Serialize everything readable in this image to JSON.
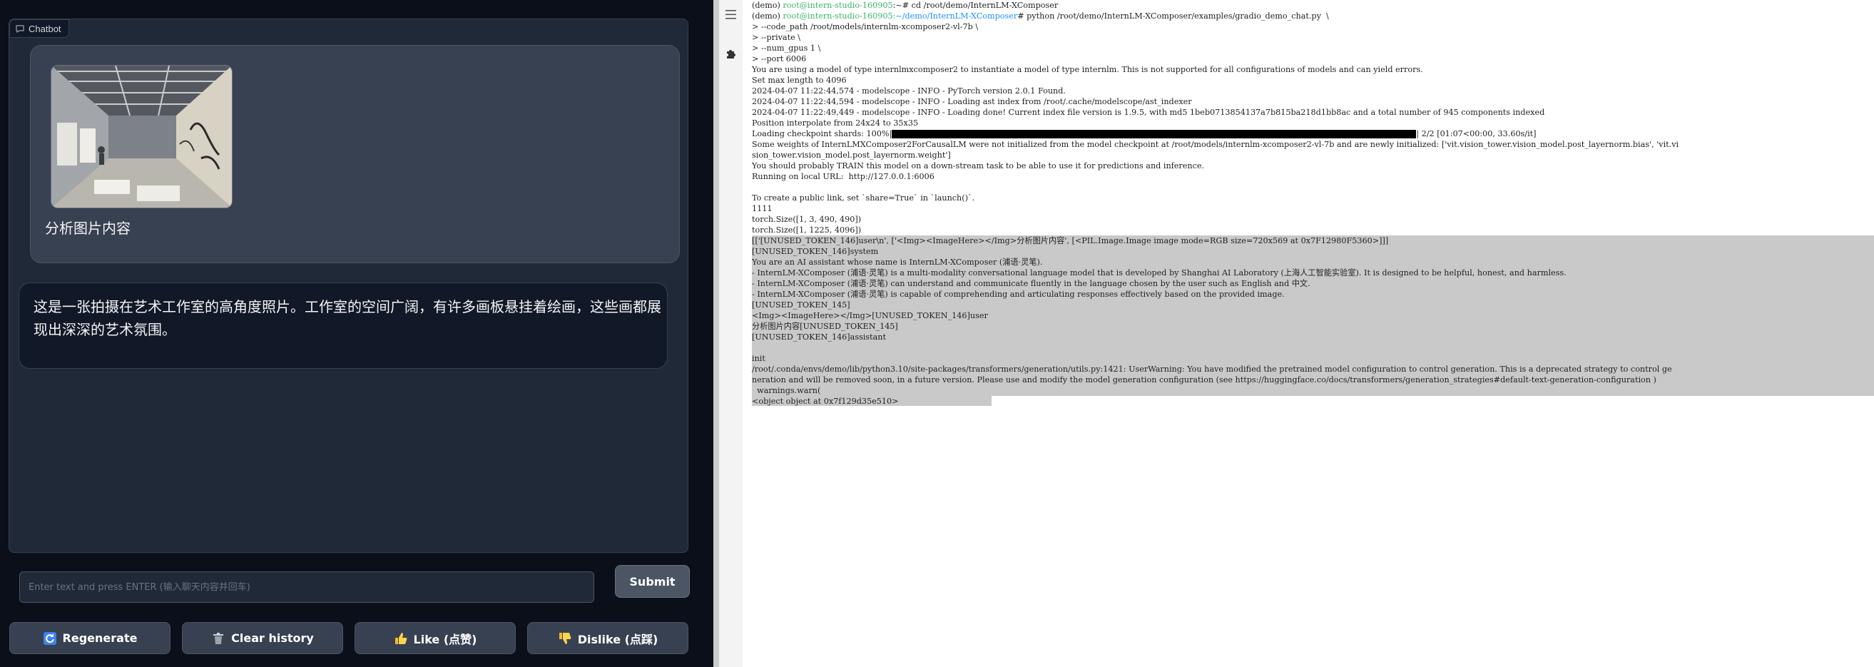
{
  "chatbot": {
    "label": "Chatbot",
    "user_message": "分析图片内容",
    "bot_message": "这是一张拍摄在艺术工作室的高角度照片。工作室的空间广阔，有许多画板悬挂着绘画，这些画都展现出深深的艺术氛围。"
  },
  "input": {
    "placeholder": "Enter text and press ENTER (输入聊天内容并回车)"
  },
  "buttons": {
    "submit": "Submit",
    "regenerate": "Regenerate",
    "clear_history": "Clear history",
    "like": "Like (点赞)",
    "dislike": "Dislike (点踩)"
  },
  "icons": {
    "chat": "chat-icon",
    "regenerate": "refresh-icon",
    "clear": "trash-icon",
    "like": "thumbs-up-icon",
    "dislike": "thumbs-down-icon",
    "sidebar_list": "list-icon",
    "sidebar_ext": "puzzle-icon"
  },
  "terminal": {
    "cmd1": {
      "env": "(demo) ",
      "user": "root@intern-studio-160905",
      "path": ":~",
      "cmd": "# cd /root/demo/InternLM-XComposer"
    },
    "cmd2": {
      "env": "(demo) ",
      "user": "root@intern-studio-160905",
      "path": ":~/demo/InternLM-XComposer",
      "cmd": "# python /root/demo/InternLM-XComposer/examples/gradio_demo_chat.py  \\"
    },
    "lines": [
      "> --code_path /root/models/internlm-xcomposer2-vl-7b \\",
      "> --private \\",
      "> --num_gpus 1 \\",
      "> --port 6006",
      "You are using a model of type internlmxcomposer2 to instantiate a model of type internlm. This is not supported for all configurations of models and can yield errors.",
      "Set max length to 4096",
      "2024-04-07 11:22:44,574 - modelscope - INFO - PyTorch version 2.0.1 Found.",
      "2024-04-07 11:22:44,594 - modelscope - INFO - Loading ast index from /root/.cache/modelscope/ast_indexer",
      "2024-04-07 11:22:49,449 - modelscope - INFO - Loading done! Current index file version is 1.9.5, with md5 1beb0713854137a7b815ba218d1bb8ac and a total number of 945 components indexed",
      "Position interpolate from 24x24 to 35x35"
    ],
    "progress": {
      "prefix": "Loading checkpoint shards: 100%|",
      "suffix": "| 2/2 [01:07<00:00, 33.60s/it]",
      "fraction": 1.0
    },
    "lines2": [
      "Some weights of InternLMXComposer2ForCausalLM were not initialized from the model checkpoint at /root/models/internlm-xcomposer2-vl-7b and are newly initialized: ['vit.vision_tower.vision_model.post_layernorm.bias', 'vit.vi",
      "sion_tower.vision_model.post_layernorm.weight']",
      "You should probably TRAIN this model on a down-stream task to be able to use it for predictions and inference.",
      "Running on local URL:  http://127.0.0.1:6006",
      "",
      "To create a public link, set `share=True` in `launch()`.",
      "1111",
      "torch.Size([1, 3, 490, 490])",
      "torch.Size([1, 1225, 4096])"
    ],
    "selected_lines": [
      "[['[UNUSED_TOKEN_146]user\\n', ['<Img><ImageHere></Img>分析图片内容', [<PIL.Image.Image image mode=RGB size=720x569 at 0x7F12980F5360>]]]",
      "[UNUSED_TOKEN_146]system",
      "You are an AI assistant whose name is InternLM-XComposer (浦语·灵笔).",
      "- InternLM-XComposer (浦语·灵笔) is a multi-modality conversational language model that is developed by Shanghai AI Laboratory (上海人工智能实验室). It is designed to be helpful, honest, and harmless.",
      "- InternLM-XComposer (浦语·灵笔) can understand and communicate fluently in the language chosen by the user such as English and 中文.",
      "- InternLM-XComposer (浦语·灵笔) is capable of comprehending and articulating responses effectively based on the provided image.",
      "[UNUSED_TOKEN_145]",
      "<Img><ImageHere></Img>[UNUSED_TOKEN_146]user",
      "分析图片内容[UNUSED_TOKEN_145]",
      "[UNUSED_TOKEN_146]assistant",
      "",
      "init",
      "/root/.conda/envs/demo/lib/python3.10/site-packages/transformers/generation/utils.py:1421: UserWarning: You have modified the pretrained model configuration to control generation. This is a deprecated strategy to control ge",
      "neration and will be removed soon, in a future version. Please use and modify the model generation configuration (see https://huggingface.co/docs/transformers/generation_strategies#default-text-generation-configuration )",
      "  warnings.warn(",
      "<object object at 0x7f129d35e510>"
    ]
  },
  "colors": {
    "gradio_bg": "#0b0f19",
    "panel_bg": "#1f2937",
    "user_bubble": "#374151",
    "bot_bubble": "#111827",
    "term_user": "#3cb371",
    "term_path": "#1e90ff",
    "selection": "#c9c9c9"
  }
}
